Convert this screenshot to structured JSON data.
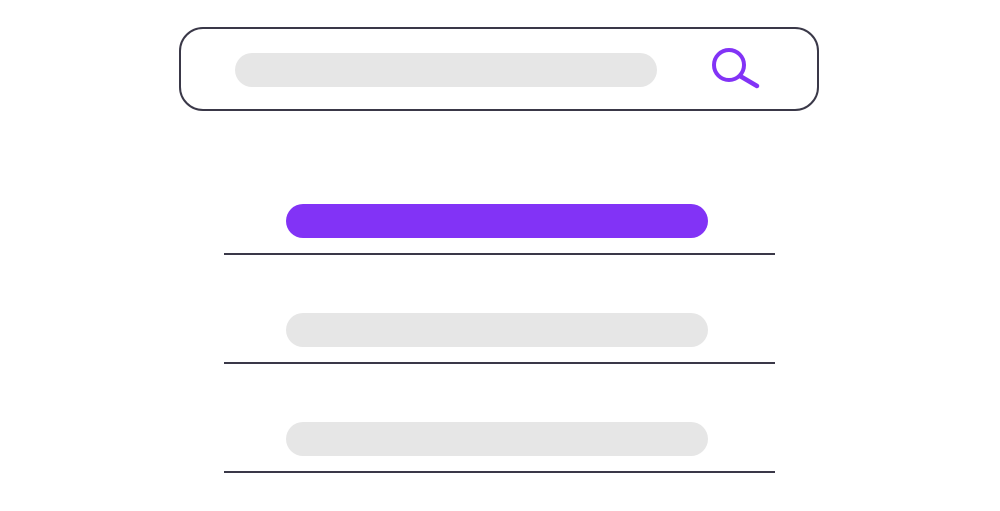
{
  "colors": {
    "accent": "#8233f6",
    "placeholder_fill": "#e6e6e6",
    "outline": "#3a3848",
    "background": "#ffffff"
  },
  "search": {
    "value": "",
    "placeholder": "",
    "icon": "search-icon"
  },
  "results": [
    {
      "label": "",
      "selected": true
    },
    {
      "label": "",
      "selected": false
    },
    {
      "label": "",
      "selected": false
    }
  ]
}
